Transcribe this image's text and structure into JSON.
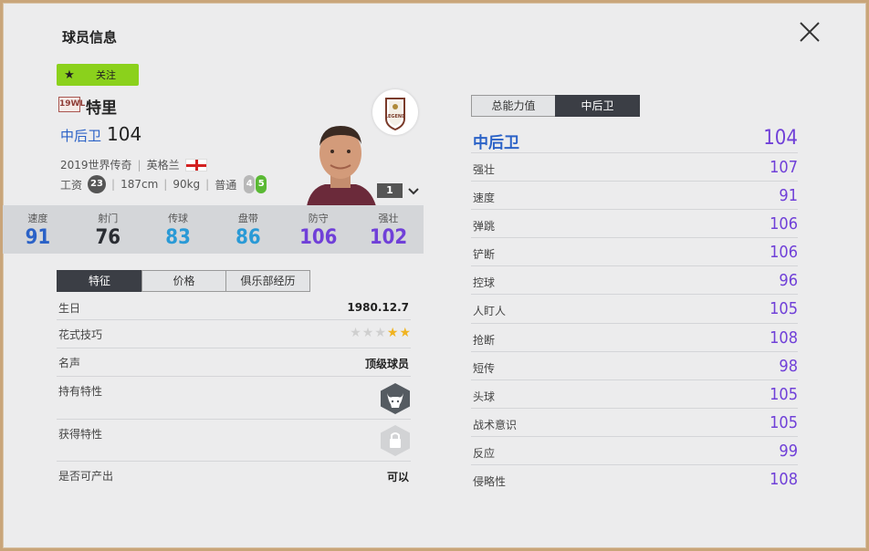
{
  "title": "球员信息",
  "follow_label": "关注",
  "season_badge": "19WL",
  "player_name": "特里",
  "position": "中后卫",
  "overall": "104",
  "meta": {
    "season": "2019世界传奇",
    "nation": "英格兰",
    "salary_label": "工资",
    "salary": "23",
    "height": "187cm",
    "weight": "90kg",
    "body_type": "普通",
    "weak_foot": "4",
    "strong_foot": "5"
  },
  "level": "1",
  "badge_text": "LEGEND",
  "stats": [
    {
      "name": "速度",
      "value": "91",
      "color": "#2b62c7"
    },
    {
      "name": "射门",
      "value": "76",
      "color": "#2a2d33"
    },
    {
      "name": "传球",
      "value": "83",
      "color": "#2a9ad6"
    },
    {
      "name": "盘带",
      "value": "86",
      "color": "#2a9ad6"
    },
    {
      "name": "防守",
      "value": "106",
      "color": "#7040d8"
    },
    {
      "name": "强壮",
      "value": "102",
      "color": "#7040d8"
    }
  ],
  "left_tabs": [
    {
      "label": "特征",
      "active": true
    },
    {
      "label": "价格",
      "active": false
    },
    {
      "label": "俱乐部经历",
      "active": false
    }
  ],
  "info": {
    "birthday_label": "生日",
    "birthday": "1980.12.7",
    "skill_label": "花式技巧",
    "skill_stars": 2,
    "reputation_label": "名声",
    "reputation": "顶级球员",
    "owned_traits_label": "持有特性",
    "gain_traits_label": "获得特性",
    "producible_label": "是否可产出",
    "producible": "可以"
  },
  "right_tabs": [
    {
      "label": "总能力值",
      "active": false
    },
    {
      "label": "中后卫",
      "active": true
    }
  ],
  "attr_header": {
    "label": "中后卫",
    "value": "104"
  },
  "attributes": [
    {
      "name": "强壮",
      "value": "107"
    },
    {
      "name": "速度",
      "value": "91"
    },
    {
      "name": "弹跳",
      "value": "106"
    },
    {
      "name": "铲断",
      "value": "106"
    },
    {
      "name": "控球",
      "value": "96"
    },
    {
      "name": "人盯人",
      "value": "105"
    },
    {
      "name": "抢断",
      "value": "108"
    },
    {
      "name": "短传",
      "value": "98"
    },
    {
      "name": "头球",
      "value": "105"
    },
    {
      "name": "战术意识",
      "value": "105"
    },
    {
      "name": "反应",
      "value": "99"
    },
    {
      "name": "侵略性",
      "value": "108"
    }
  ],
  "colors": {
    "purple": "#7040d8",
    "blue": "#2b62c7",
    "follow_green": "#8bd11c"
  }
}
